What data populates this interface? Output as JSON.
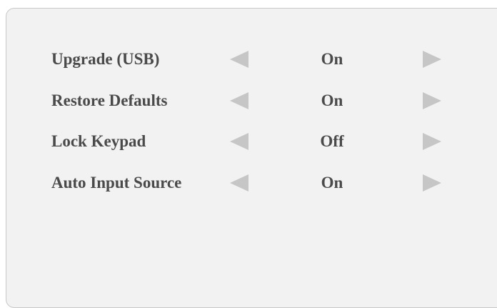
{
  "menu": {
    "items": [
      {
        "label": "Upgrade (USB)",
        "value": "On"
      },
      {
        "label": "Restore Defaults",
        "value": "On"
      },
      {
        "label": "Lock Keypad",
        "value": "Off"
      },
      {
        "label": "Auto Input Source",
        "value": "On"
      }
    ],
    "arrow_color": "#c6c6c6",
    "text_color": "#4a4a4a",
    "panel_background": "#f2f2f2"
  },
  "icons": {
    "left": "triangle-left-icon",
    "right": "triangle-right-icon"
  }
}
